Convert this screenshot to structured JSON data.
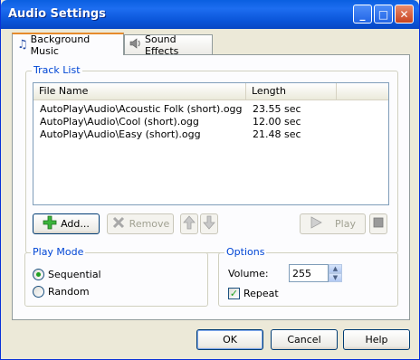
{
  "window": {
    "title": "Audio Settings"
  },
  "titlebar_buttons": {
    "minimize": "_",
    "maximize": "□",
    "close": "✕"
  },
  "tabs": [
    {
      "label": "Background Music",
      "icon": "music-note-icon",
      "active": true
    },
    {
      "label": "Sound Effects",
      "icon": "speaker-icon",
      "active": false
    }
  ],
  "track_list": {
    "group_label": "Track List",
    "columns": [
      "File Name",
      "Length"
    ],
    "rows": [
      {
        "file": "AutoPlay\\Audio\\Acoustic Folk (short).ogg",
        "length": "23.55 sec"
      },
      {
        "file": "AutoPlay\\Audio\\Cool (short).ogg",
        "length": "12.00 sec"
      },
      {
        "file": "AutoPlay\\Audio\\Easy (short).ogg",
        "length": "21.48 sec"
      }
    ]
  },
  "actions": {
    "add": "Add...",
    "remove": "Remove",
    "play": "Play"
  },
  "play_mode": {
    "label": "Play Mode",
    "sequential": "Sequential",
    "random": "Random",
    "selected": "Sequential"
  },
  "options": {
    "label": "Options",
    "volume_label": "Volume:",
    "volume_value": "255",
    "repeat_label": "Repeat",
    "repeat_checked": true
  },
  "dialog_buttons": {
    "ok": "OK",
    "cancel": "Cancel",
    "help": "Help"
  },
  "colors": {
    "titlebar": "#0a5fe0",
    "group_label": "#0046d5",
    "face": "#ece9d8"
  }
}
